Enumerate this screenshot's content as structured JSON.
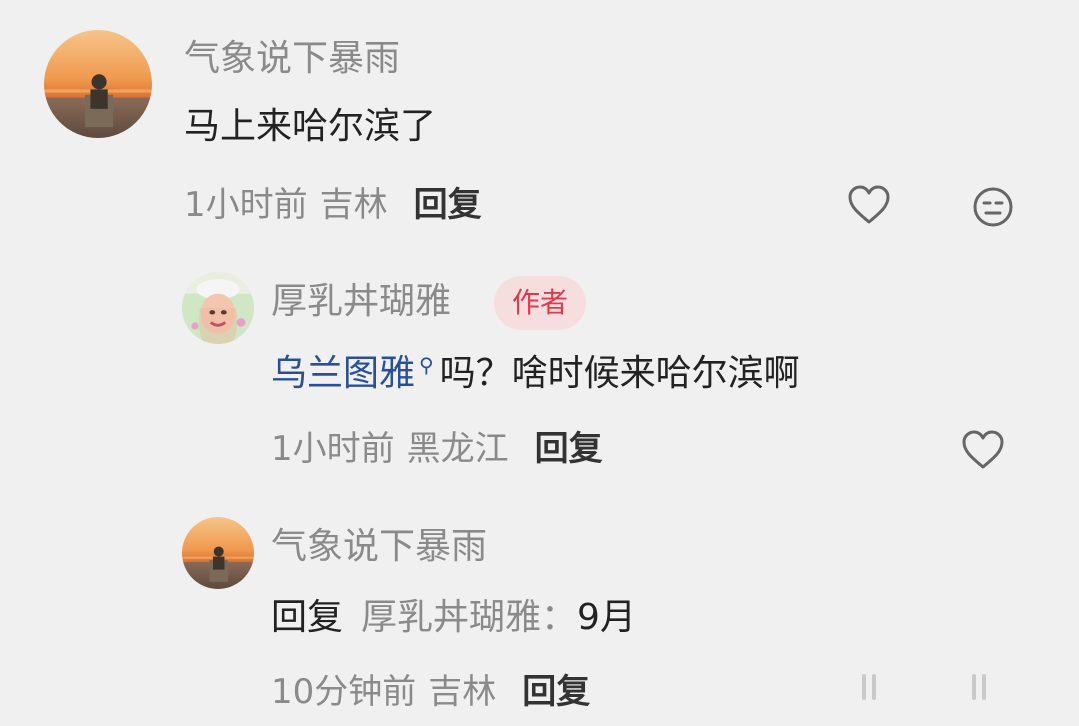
{
  "comments": [
    {
      "username": "气象说下暴雨",
      "text": "马上来哈尔滨了",
      "time": "1小时前",
      "location": "吉林",
      "reply_label": "回复",
      "icons": [
        "heart-icon",
        "neutral-face-icon"
      ]
    },
    {
      "username": "厚乳丼瑚雅",
      "badge": "作者",
      "mention": "乌兰图雅",
      "mention_icon": "search-icon",
      "text": "吗？啥时候来哈尔滨啊",
      "time": "1小时前",
      "location": "黑龙江",
      "reply_label": "回复",
      "icons": [
        "heart-icon"
      ]
    },
    {
      "username": "气象说下暴雨",
      "reply_prefix": "回复",
      "reply_target": "厚乳丼瑚雅",
      "text": "9月",
      "time": "10分钟前",
      "location": "吉林",
      "reply_label": "回复"
    }
  ],
  "colors": {
    "background": "#f0f0f0",
    "username": "#8a8a8a",
    "mention": "#2a4f9a",
    "badge_text": "#e0394b",
    "badge_bg": "#f7dede"
  }
}
